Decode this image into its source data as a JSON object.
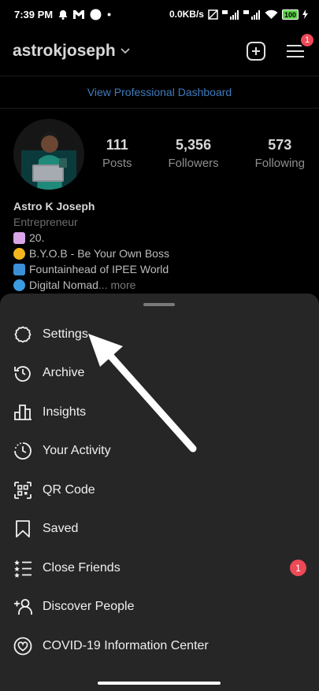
{
  "status_bar": {
    "time": "7:39 PM",
    "speed": "0.0KB/s",
    "battery": "100"
  },
  "header": {
    "username": "astrokjoseph",
    "menu_badge": "1"
  },
  "pro_dashboard": "View Professional Dashboard",
  "profile": {
    "stats": [
      {
        "value": "111",
        "label": "Posts"
      },
      {
        "value": "5,356",
        "label": "Followers"
      },
      {
        "value": "573",
        "label": "Following"
      }
    ],
    "name": "Astro K Joseph",
    "category": "Entrepreneur",
    "bio_lines": [
      "20.",
      "B.Y.O.B - Be Your Own Boss",
      "Fountainhead of IPEE World",
      "Digital Nomad"
    ],
    "more": "... more"
  },
  "menu": {
    "items": [
      {
        "label": "Settings",
        "icon": "settings-icon"
      },
      {
        "label": "Archive",
        "icon": "archive-icon"
      },
      {
        "label": "Insights",
        "icon": "insights-icon"
      },
      {
        "label": "Your Activity",
        "icon": "activity-icon"
      },
      {
        "label": "QR Code",
        "icon": "qr-code-icon"
      },
      {
        "label": "Saved",
        "icon": "bookmark-icon"
      },
      {
        "label": "Close Friends",
        "icon": "close-friends-icon",
        "badge": "1"
      },
      {
        "label": "Discover People",
        "icon": "add-person-icon"
      },
      {
        "label": "COVID-19 Information Center",
        "icon": "covid-info-icon"
      }
    ]
  },
  "colors": {
    "accent_link": "#3e7bbd",
    "badge": "#ed4956",
    "sheet": "#262626"
  }
}
